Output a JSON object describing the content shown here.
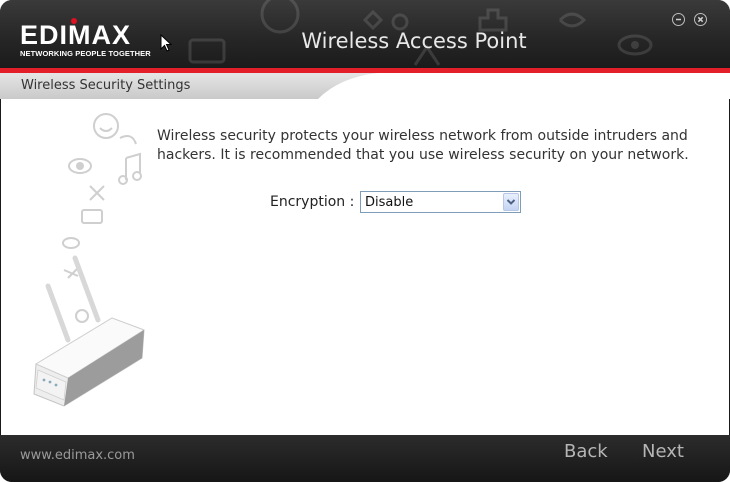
{
  "header": {
    "logo_text": "EDIMAX",
    "logo_tagline": "NETWORKING PEOPLE TOGETHER",
    "title": "Wireless Access Point",
    "minimize_icon": "minus-circle-icon",
    "close_icon": "x-circle-icon"
  },
  "section": {
    "title": "Wireless Security Settings"
  },
  "content": {
    "intro_line1": "Wireless security protects your wireless network from outside intruders and",
    "intro_line2": "hackers. It is recommended that you use wireless security on your network.",
    "encryption_label": "Encryption :",
    "encryption_value": "Disable"
  },
  "footer": {
    "url": "www.edimax.com",
    "back_label": "Back",
    "next_label": "Next"
  },
  "colors": {
    "accent_red": "#e3202a",
    "header_dark": "#262626",
    "footer_dark": "#1c1c1c"
  }
}
